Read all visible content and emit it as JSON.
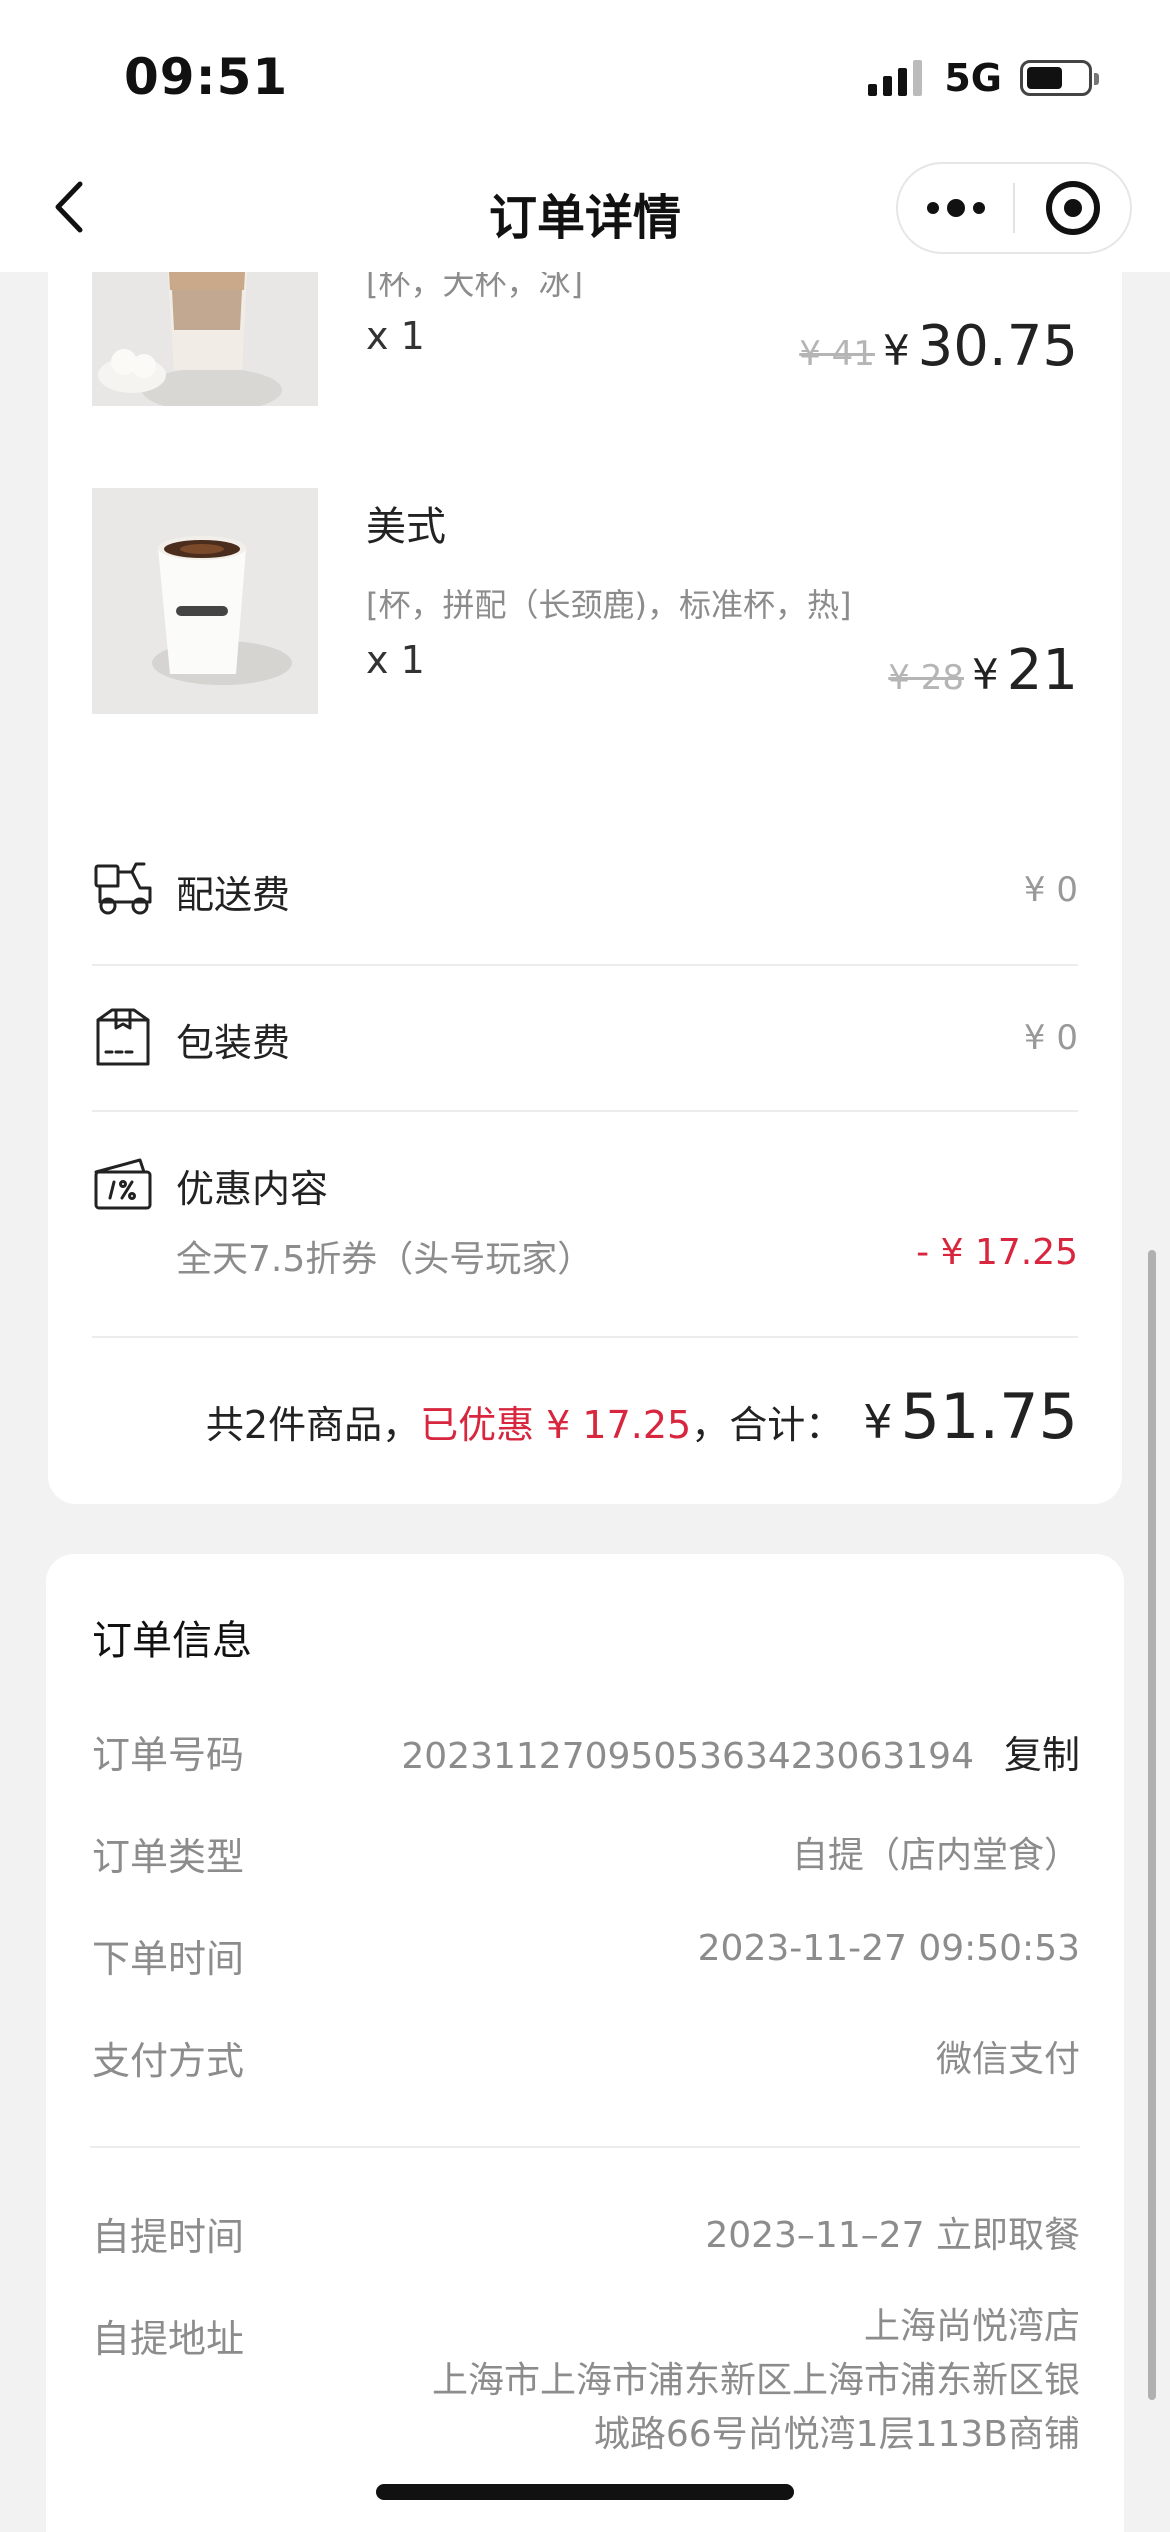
{
  "status_bar": {
    "time": "09:51",
    "network": "5G"
  },
  "nav": {
    "title": "订单详情"
  },
  "products": [
    {
      "spec": "[杯，大杯，冰]",
      "qty": "x 1",
      "orig_price": "¥ 41",
      "yen": "¥",
      "price": "30.75"
    },
    {
      "name": "美式",
      "spec": "[杯，拼配（长颈鹿)，标准杯，热]",
      "qty": "x 1",
      "orig_price": "¥ 28",
      "yen": "¥",
      "price": "21"
    }
  ],
  "fees": {
    "delivery": {
      "label": "配送费",
      "value": "¥ 0"
    },
    "packing": {
      "label": "包装费",
      "value": "¥ 0"
    },
    "discount": {
      "label": "优惠内容",
      "detail": "全天7.5折券（头号玩家）",
      "value": "- ¥ 17.25"
    }
  },
  "summary": {
    "items_text": "共2件商品，",
    "discounted_text": "已优惠 ¥ 17.25",
    "total_label": "，合计：",
    "yen": "¥",
    "total": "51.75"
  },
  "order_info": {
    "title": "订单信息",
    "order_no_label": "订单号码",
    "order_no": "20231127095053634230631​94",
    "copy_label": "复制",
    "type_label": "订单类型",
    "type": "自提（店内堂食）",
    "time_label": "下单时间",
    "time": "2023-11-27 09:50:53",
    "pay_label": "支付方式",
    "pay": "微信支付",
    "pickup_time_label": "自提时间",
    "pickup_time": "2023–11–27 立即取餐",
    "pickup_addr_label": "自提地址",
    "pickup_store": "上海尚悦湾店",
    "pickup_addr_line1": "上海市上海市浦东新区上海市浦东新区银",
    "pickup_addr_line2": "城路66号尚悦湾1层113B商铺"
  },
  "colors": {
    "accent_red": "#d7263d",
    "text_gray": "#8c8c8c",
    "background": "#f2f2f2"
  }
}
